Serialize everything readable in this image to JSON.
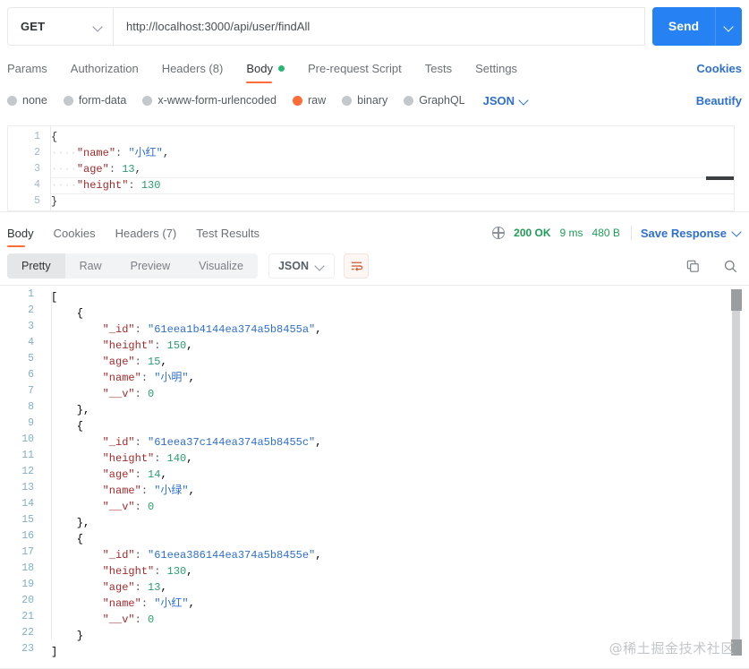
{
  "request": {
    "method": "GET",
    "url": "http://localhost:3000/api/user/findAll",
    "send_label": "Send",
    "tabs": [
      {
        "label": "Params",
        "active": false
      },
      {
        "label": "Authorization",
        "active": false
      },
      {
        "label": "Headers (8)",
        "active": false
      },
      {
        "label": "Body",
        "active": true,
        "dot": true
      },
      {
        "label": "Pre-request Script",
        "active": false
      },
      {
        "label": "Tests",
        "active": false
      },
      {
        "label": "Settings",
        "active": false
      }
    ],
    "cookies_link": "Cookies",
    "beautify_link": "Beautify",
    "body_types": [
      {
        "label": "none",
        "selected": false
      },
      {
        "label": "form-data",
        "selected": false
      },
      {
        "label": "x-www-form-urlencoded",
        "selected": false
      },
      {
        "label": "raw",
        "selected": true
      },
      {
        "label": "binary",
        "selected": false
      },
      {
        "label": "GraphQL",
        "selected": false
      }
    ],
    "raw_format": "JSON",
    "editor": {
      "line_numbers": [
        "1",
        "2",
        "3",
        "4",
        "5"
      ],
      "lines": [
        "{",
        "    \"name\": \"小红\",",
        "    \"age\": 13,",
        "    \"height\": 130",
        "}"
      ]
    }
  },
  "response": {
    "tabs": [
      {
        "label": "Body",
        "active": true
      },
      {
        "label": "Cookies",
        "active": false
      },
      {
        "label": "Headers (7)",
        "active": false
      },
      {
        "label": "Test Results",
        "active": false
      }
    ],
    "status": "200 OK",
    "time": "9 ms",
    "size": "480 B",
    "save_response_label": "Save Response",
    "view_modes": [
      {
        "label": "Pretty",
        "active": true
      },
      {
        "label": "Raw",
        "active": false
      },
      {
        "label": "Preview",
        "active": false
      },
      {
        "label": "Visualize",
        "active": false
      }
    ],
    "format": "JSON",
    "line_numbers": [
      "1",
      "2",
      "3",
      "4",
      "5",
      "6",
      "7",
      "8",
      "9",
      "10",
      "11",
      "12",
      "13",
      "14",
      "15",
      "16",
      "17",
      "18",
      "19",
      "20",
      "21",
      "22",
      "23"
    ],
    "body_lines": [
      "[",
      "    {",
      "        \"_id\": \"61eea1b4144ea374a5b8455a\",",
      "        \"height\": 150,",
      "        \"age\": 15,",
      "        \"name\": \"小明\",",
      "        \"__v\": 0",
      "    },",
      "    {",
      "        \"_id\": \"61eea37c144ea374a5b8455c\",",
      "        \"height\": 140,",
      "        \"age\": 14,",
      "        \"name\": \"小绿\",",
      "        \"__v\": 0",
      "    },",
      "    {",
      "        \"_id\": \"61eea386144ea374a5b8455e\",",
      "        \"height\": 130,",
      "        \"age\": 13,",
      "        \"name\": \"小红\",",
      "        \"__v\": 0",
      "    }",
      "]"
    ],
    "json_data": [
      {
        "_id": "61eea1b4144ea374a5b8455a",
        "height": 150,
        "age": 15,
        "name": "小明",
        "__v": 0
      },
      {
        "_id": "61eea37c144ea374a5b8455c",
        "height": 140,
        "age": 14,
        "name": "小绿",
        "__v": 0
      },
      {
        "_id": "61eea386144ea374a5b8455e",
        "height": 130,
        "age": 13,
        "name": "小红",
        "__v": 0
      }
    ]
  },
  "watermark": "@稀土掘金技术社区",
  "colors": {
    "accent_orange": "#ff6c37",
    "send_blue": "#2681f2",
    "link_blue": "#2f6fd0",
    "status_green": "#1f9d55"
  }
}
